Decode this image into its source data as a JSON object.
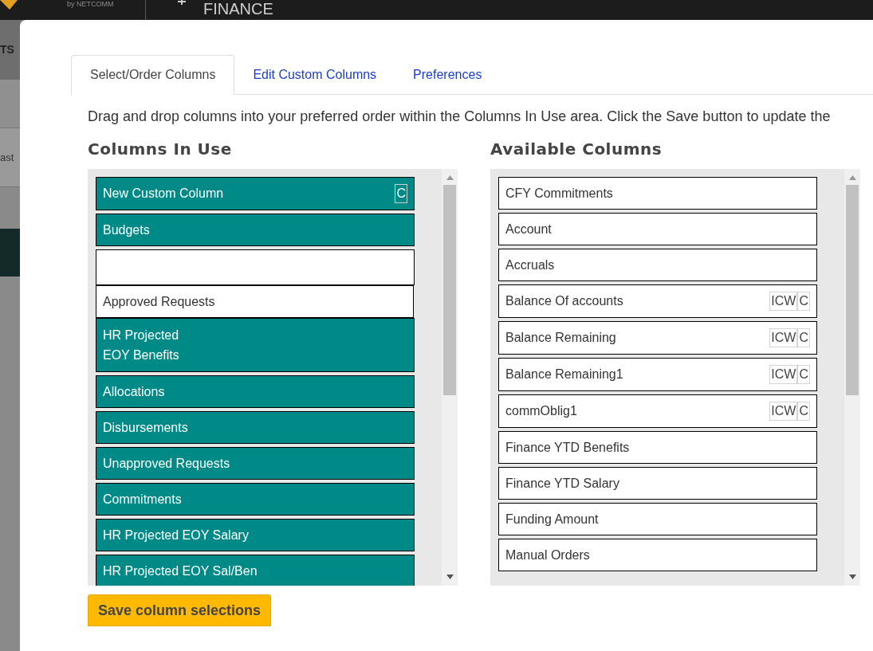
{
  "header": {
    "logo_tagline": "by NETCOMM",
    "title": "FINANCE"
  },
  "sidebar": {
    "items": [
      {
        "label": "TS"
      },
      {
        "label": "ast"
      }
    ]
  },
  "dialog": {
    "tabs": [
      {
        "label": "Select/Order Columns",
        "selected": true
      },
      {
        "label": "Edit Custom Columns",
        "selected": false
      },
      {
        "label": "Preferences",
        "selected": false
      }
    ],
    "instructions": "Drag and drop columns into your preferred order within the Columns In Use area. Click the Save button to update the",
    "columns_in_use": {
      "title": "Columns In Use",
      "items": [
        {
          "kind": "column",
          "label": "New Custom Column",
          "tags": [
            "C"
          ]
        },
        {
          "kind": "column",
          "label": "Budgets"
        },
        {
          "kind": "drop-slot"
        },
        {
          "kind": "dragged",
          "label": "Approved Requests"
        },
        {
          "kind": "column",
          "label": "HR Projected\nEOY Benefits"
        },
        {
          "kind": "column",
          "label": "Allocations"
        },
        {
          "kind": "column",
          "label": "Disbursements"
        },
        {
          "kind": "column",
          "label": "Unapproved Requests"
        },
        {
          "kind": "column",
          "label": "Commitments"
        },
        {
          "kind": "column",
          "label": "HR Projected EOY Salary"
        },
        {
          "kind": "column",
          "label": "HR Projected EOY Sal/Ben"
        }
      ]
    },
    "available_columns": {
      "title": "Available Columns",
      "items": [
        {
          "kind": "column",
          "label": "CFY Commitments"
        },
        {
          "kind": "column",
          "label": "Account"
        },
        {
          "kind": "column",
          "label": "Accruals"
        },
        {
          "kind": "column",
          "label": "Balance Of accounts",
          "tags": [
            "ICW",
            "C"
          ]
        },
        {
          "kind": "column",
          "label": "Balance Remaining",
          "tags": [
            "ICW",
            "C"
          ]
        },
        {
          "kind": "column",
          "label": "Balance Remaining1",
          "tags": [
            "ICW",
            "C"
          ]
        },
        {
          "kind": "column",
          "label": "commOblig1",
          "tags": [
            "ICW",
            "C"
          ]
        },
        {
          "kind": "column",
          "label": "Finance YTD Benefits"
        },
        {
          "kind": "column",
          "label": "Finance YTD Salary"
        },
        {
          "kind": "column",
          "label": "Funding Amount"
        },
        {
          "kind": "column",
          "label": "Manual Orders"
        }
      ]
    },
    "save_button": "Save column selections"
  }
}
